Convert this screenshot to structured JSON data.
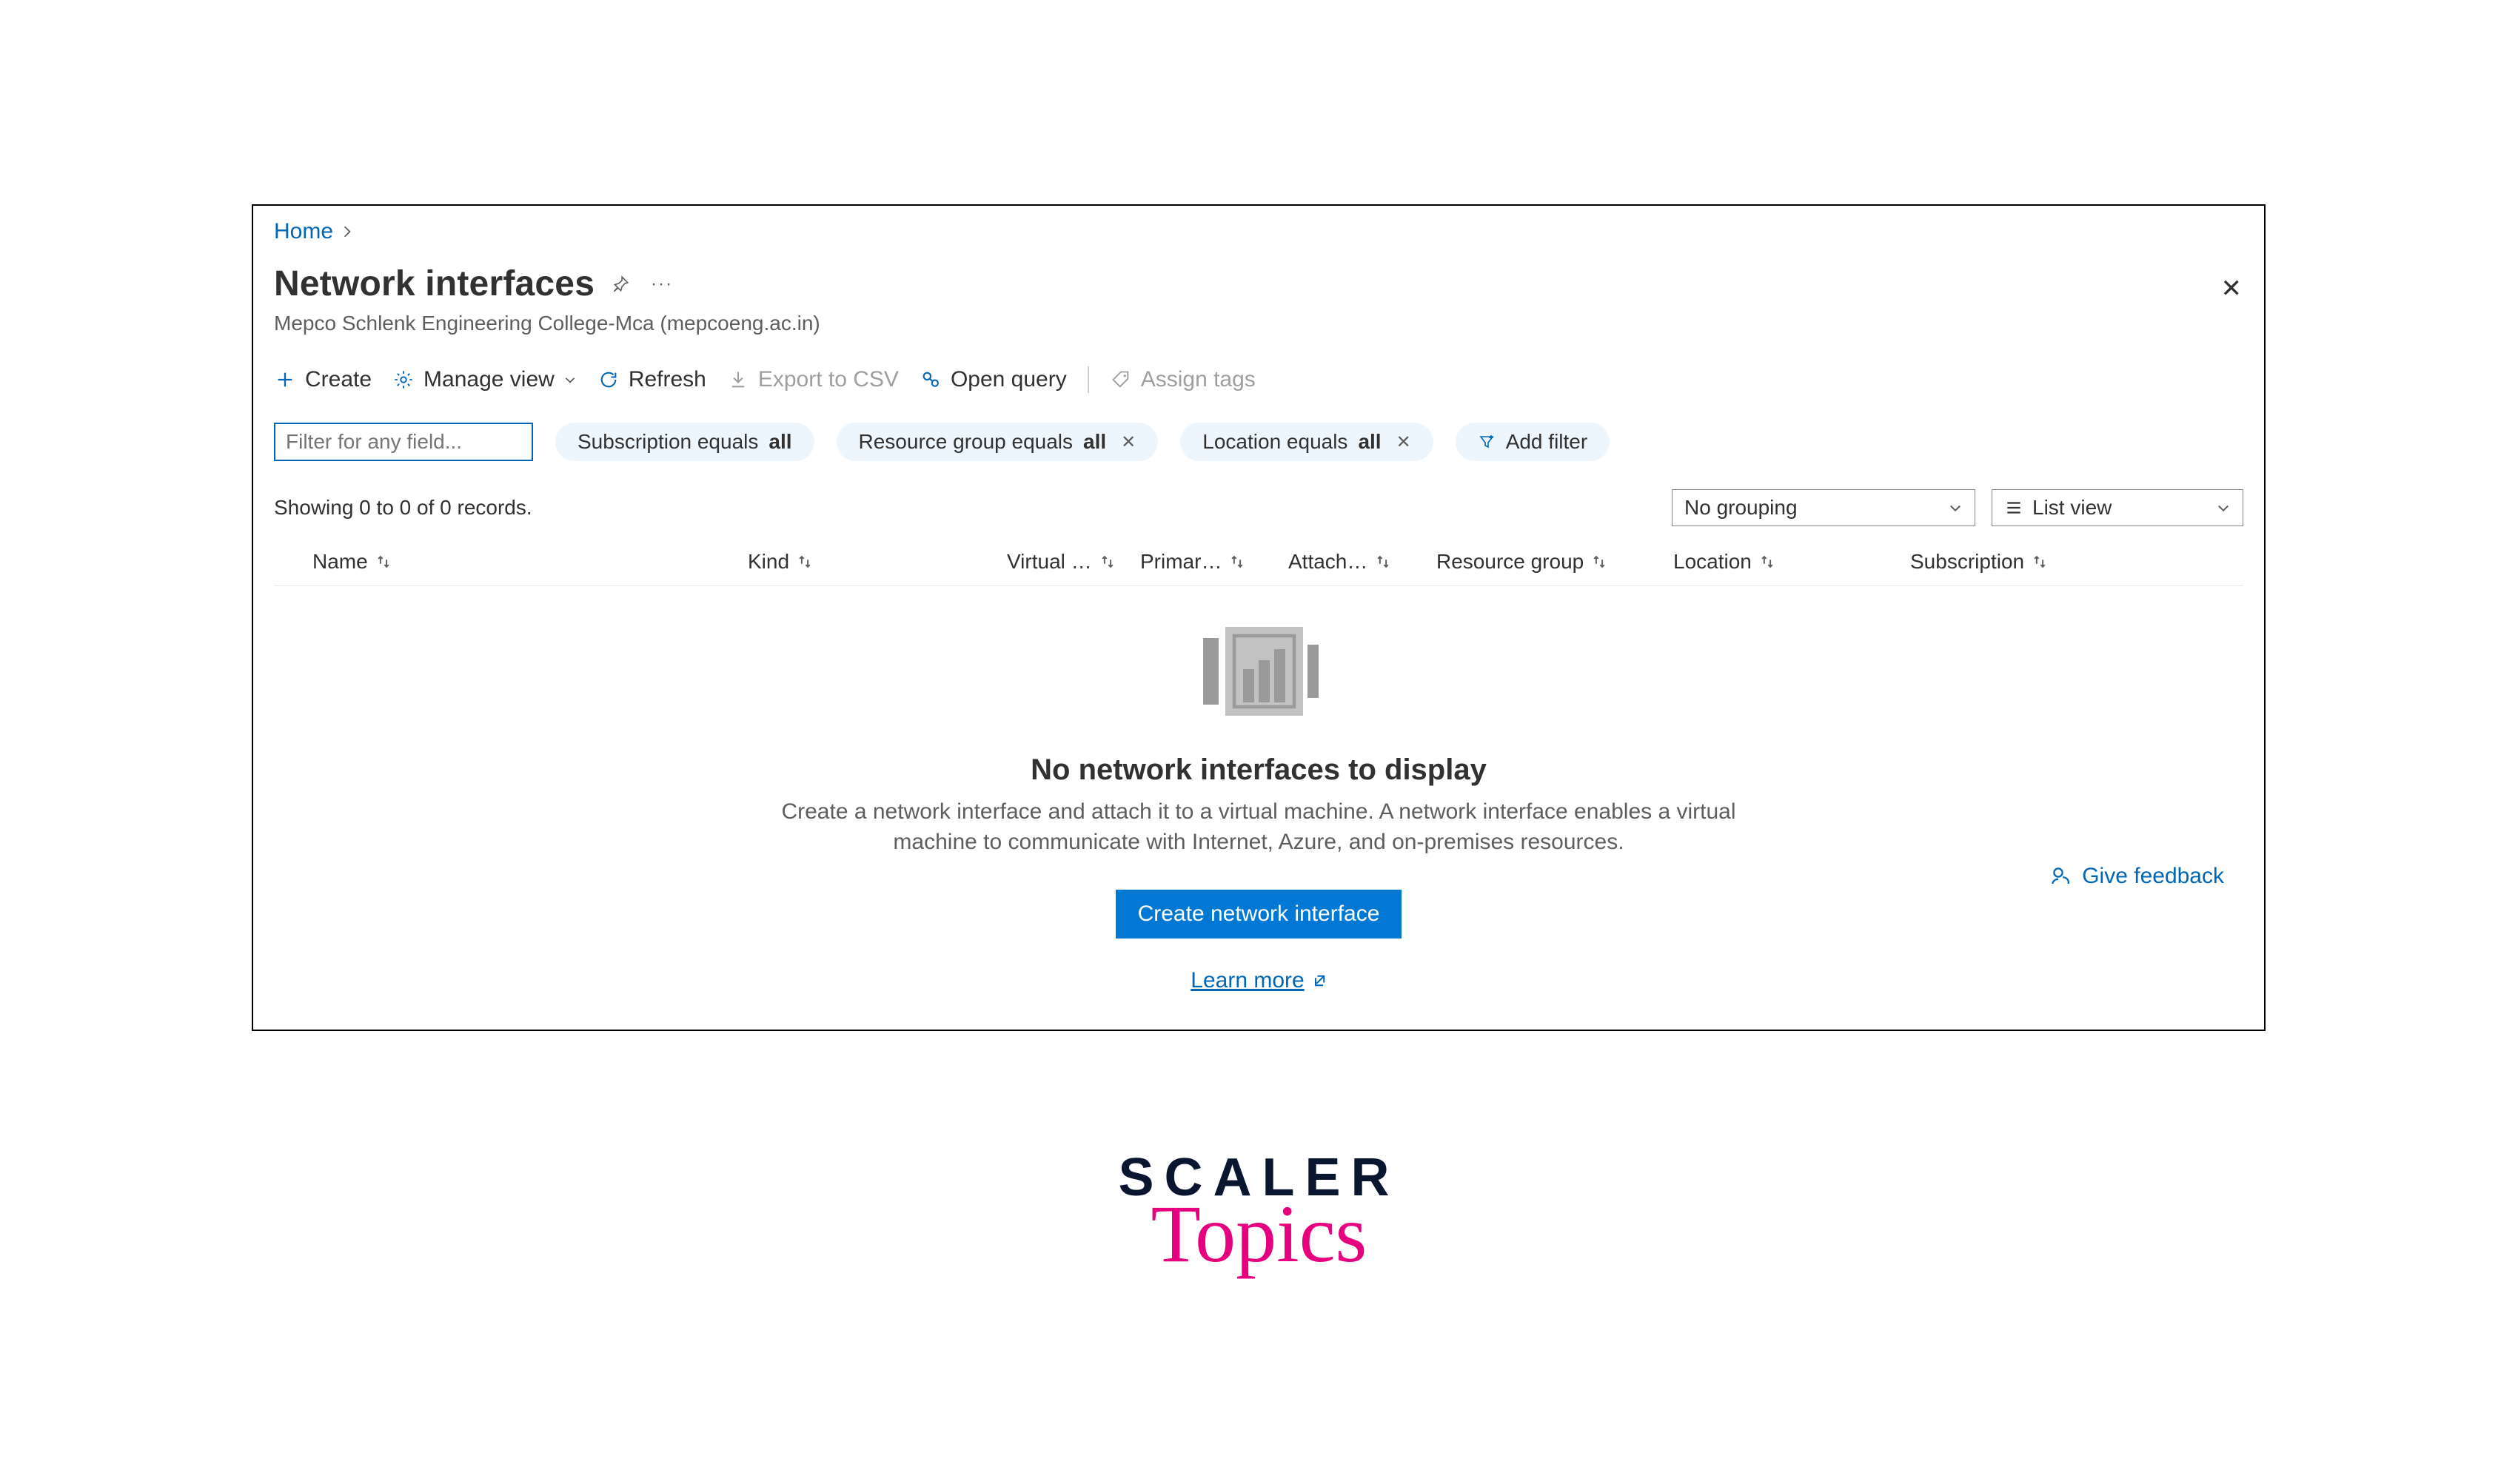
{
  "breadcrumb": {
    "home": "Home"
  },
  "header": {
    "title": "Network interfaces",
    "subtitle": "Mepco Schlenk Engineering College-Mca (mepcoeng.ac.in)"
  },
  "commands": {
    "create": "Create",
    "manage_view": "Manage view",
    "refresh": "Refresh",
    "export_csv": "Export to CSV",
    "open_query": "Open query",
    "assign_tags": "Assign tags"
  },
  "filter": {
    "placeholder": "Filter for any field...",
    "pills": {
      "subscription_prefix": "Subscription equals ",
      "subscription_value": "all",
      "rg_prefix": "Resource group equals ",
      "rg_value": "all",
      "loc_prefix": "Location equals ",
      "loc_value": "all",
      "add_filter": "Add filter"
    }
  },
  "summary": {
    "text": "Showing 0 to 0 of 0 records."
  },
  "views": {
    "grouping": "No grouping",
    "list_view": "List view"
  },
  "columns": {
    "name": "Name",
    "kind": "Kind",
    "virtual": "Virtual …",
    "primary": "Primar…",
    "attach": "Attach…",
    "rg": "Resource group",
    "location": "Location",
    "subscription": "Subscription"
  },
  "empty": {
    "title": "No network interfaces to display",
    "desc": "Create a network interface and attach it to a virtual machine. A network interface enables a virtual machine to communicate with Internet, Azure, and on-premises resources.",
    "button": "Create network interface",
    "learn_more": "Learn more"
  },
  "feedback": {
    "label": "Give feedback"
  },
  "logo": {
    "top": "SCALER",
    "bottom": "Topics"
  }
}
